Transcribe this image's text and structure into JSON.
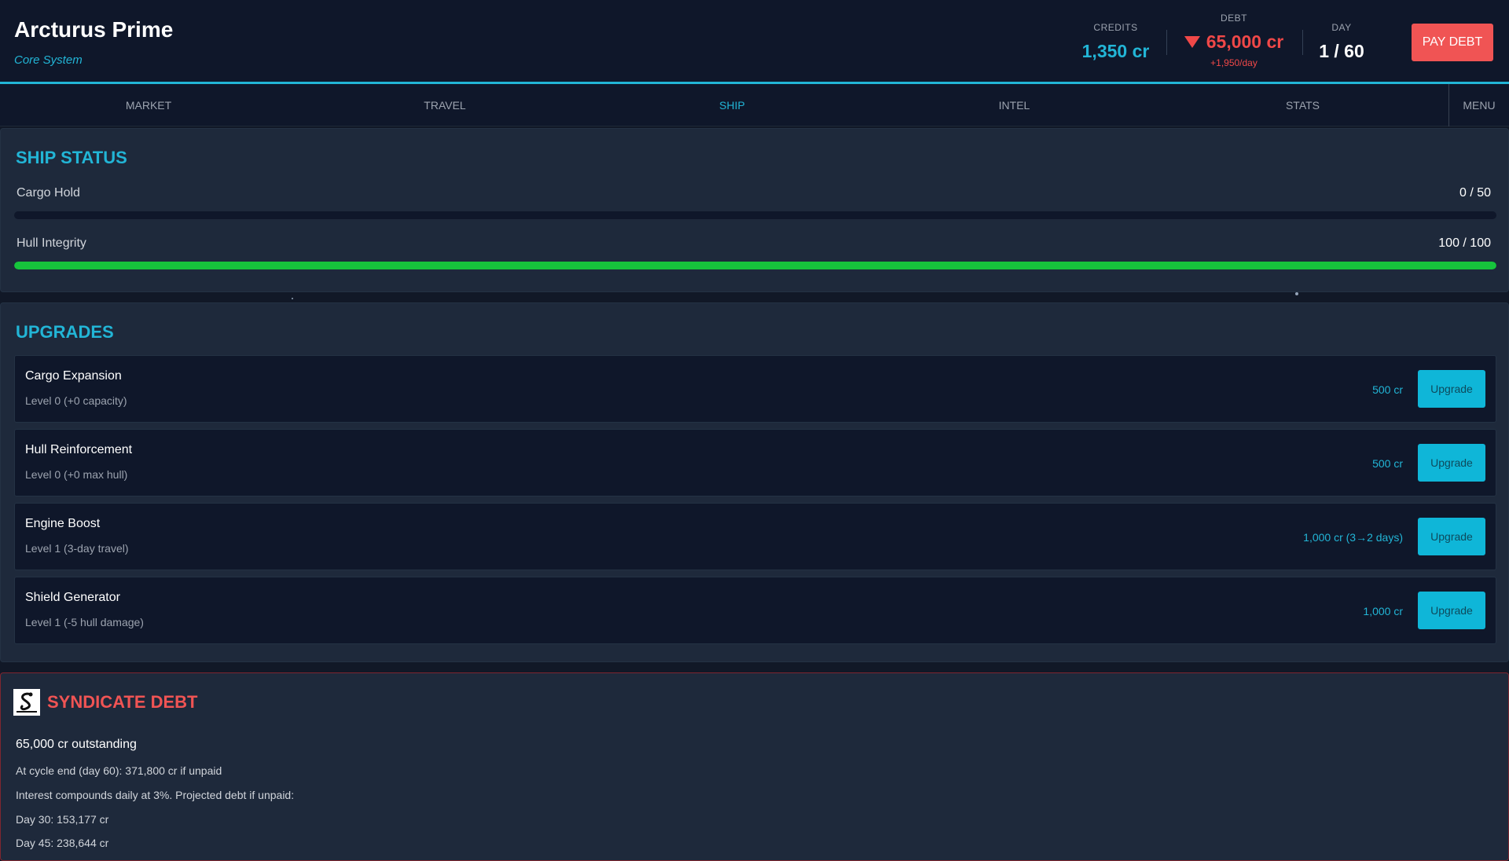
{
  "header": {
    "station_name": "Arcturus Prime",
    "system_name": "Core System",
    "credits_label": "CREDITS",
    "credits_value": "1,350 cr",
    "debt_label": "DEBT",
    "debt_value": "65,000 cr",
    "debt_rate": "+1,950/day",
    "day_label": "DAY",
    "day_value": "1 / 60",
    "pay_debt_label": "PAY DEBT"
  },
  "nav": {
    "tabs": [
      {
        "label": "MARKET"
      },
      {
        "label": "TRAVEL"
      },
      {
        "label": "SHIP"
      },
      {
        "label": "INTEL"
      },
      {
        "label": "STATS"
      }
    ],
    "active_tab": "SHIP",
    "menu_label": "MENU"
  },
  "ship_status": {
    "title": "SHIP STATUS",
    "cargo": {
      "label": "Cargo Hold",
      "value": "0 / 50",
      "fraction": 0
    },
    "hull": {
      "label": "Hull Integrity",
      "value": "100 / 100",
      "fraction": 1
    }
  },
  "upgrades": {
    "title": "UPGRADES",
    "items": [
      {
        "name": "Cargo Expansion",
        "level": "Level 0  (+0 capacity)",
        "cost": "500 cr",
        "button": "Upgrade"
      },
      {
        "name": "Hull Reinforcement",
        "level": "Level 0  (+0 max hull)",
        "cost": "500 cr",
        "button": "Upgrade"
      },
      {
        "name": "Engine Boost",
        "level": "Level 1  (3-day travel)",
        "cost": "1,000 cr  (3→2 days)",
        "button": "Upgrade"
      },
      {
        "name": "Shield Generator",
        "level": "Level 1  (-5 hull damage)",
        "cost": "1,000 cr",
        "button": "Upgrade"
      }
    ]
  },
  "syndicate_debt": {
    "title": "SYNDICATE DEBT",
    "logo_caption": "The Syndicate",
    "outstanding": "65,000 cr outstanding",
    "lines": [
      "At cycle end (day 60): 371,800 cr if unpaid",
      "Interest compounds daily at 3%. Projected debt if unpaid:",
      "Day 30: 153,177 cr",
      "Day 45: 238,644 cr"
    ]
  },
  "colors": {
    "accent": "#22b5d6",
    "debt_red": "#f04848",
    "hull_green": "#16c43c",
    "background": "#111827"
  }
}
